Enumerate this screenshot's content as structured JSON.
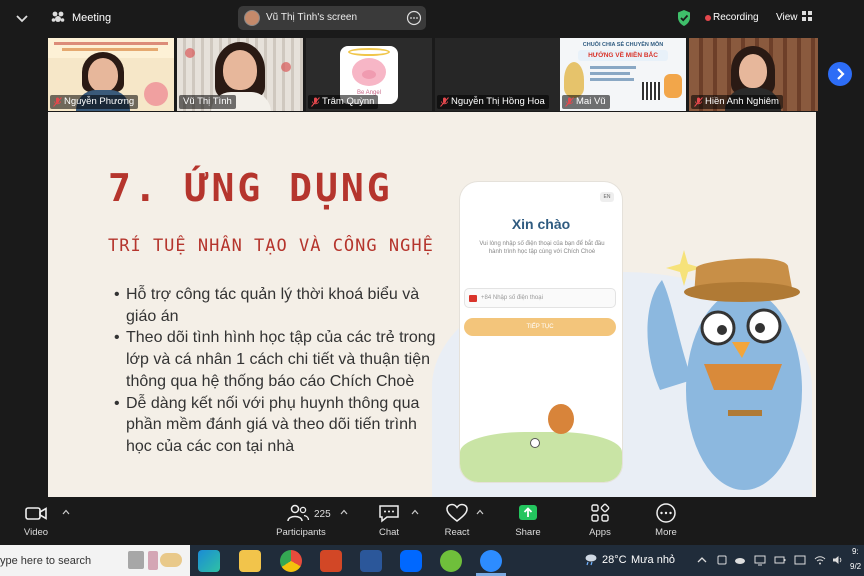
{
  "app": {
    "meeting_label": "Meeting"
  },
  "header": {
    "screen_share_label": "Vũ Thị Tình's screen",
    "recording_label": "Recording",
    "view_label": "View",
    "colors": {
      "recording": "#e5484d",
      "security": "#3fbf6a"
    }
  },
  "participants": [
    {
      "name": "Nguyễn Phương",
      "muted": true,
      "active": false,
      "art": "poster-woman"
    },
    {
      "name": "Vũ Thị Tình",
      "muted": false,
      "active": true,
      "art": "woman-camera"
    },
    {
      "name": "Trâm Quỳnn",
      "muted": true,
      "active": false,
      "art": "pig-avatar",
      "avatar_text": "Be Angel"
    },
    {
      "name": "Nguyễn Thị Hồng Hoa",
      "muted": true,
      "active": false,
      "art": "blank"
    },
    {
      "name": "Mai Vũ",
      "muted": true,
      "active": false,
      "art": "poster",
      "poster_text": [
        "CHUỖI CHIA SẺ CHUYÊN MÔN",
        "HƯỚNG VỀ MIỀN BẮC"
      ]
    },
    {
      "name": "Hiền Anh Nghiêm",
      "muted": true,
      "active": false,
      "art": "woman-office"
    }
  ],
  "slide": {
    "title": "7. ỨNG DỤNG",
    "subtitle": "TRÍ TUỆ NHÂN TẠO VÀ CÔNG NGHỆ",
    "bullets": [
      "Hỗ trợ công tác quản lý thời khoá biểu và giáo án",
      "Theo dõi tình hình học tập của các trẻ trong lớp  và cá nhân 1 cách chi tiết và thuận tiện thông qua hệ thống báo cáo Chích Choè",
      "Dễ dàng kết nối với phụ huynh thông qua phần mềm đánh giá và theo dõi tiến trình học của các con tại nhà"
    ],
    "phone": {
      "lang": "EN",
      "greeting": "Xin chào",
      "description": "Vui lòng nhập số điện thoại của bạn để bắt đầu hành trình học tập cùng với Chích Choè",
      "country_code": "+84",
      "phone_placeholder": "Nhập số điện thoại",
      "continue_label": "TIẾP TỤC"
    },
    "colors": {
      "title": "#b5352d",
      "background": "#f4efe7"
    }
  },
  "toolbar": {
    "video_label": "Video",
    "participants_count": "225",
    "participants_label": "Participants",
    "chat_label": "Chat",
    "react_label": "React",
    "share_label": "Share",
    "apps_label": "Apps",
    "more_label": "More",
    "colors": {
      "share": "#23c55e"
    }
  },
  "taskbar": {
    "search_text": "ype here to search",
    "temperature": "28°C",
    "weather": "Mưa nhỏ",
    "time_partial": "9:",
    "date_partial": "9/2",
    "apps": [
      "edge-icon",
      "file-explorer-icon",
      "chrome-icon",
      "powerpoint-icon",
      "word-icon",
      "zalo-icon",
      "app-icon",
      "zoom-icon"
    ]
  }
}
